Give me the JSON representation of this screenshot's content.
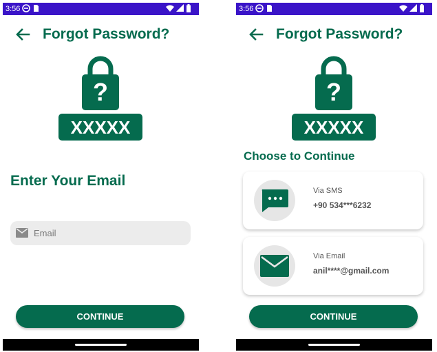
{
  "status_bar": {
    "time": "3:56"
  },
  "screens": {
    "enter_email": {
      "title": "Forgot Password?",
      "heading": "Enter Your Email",
      "email_placeholder": "Email",
      "continue_label": "CONTINUE"
    },
    "choose_method": {
      "title": "Forgot Password?",
      "heading": "Choose to Continue",
      "options": [
        {
          "label": "Via SMS",
          "value": "+90 534***6232",
          "icon": "sms-icon"
        },
        {
          "label": "Via Email",
          "value": "anil****@gmail.com",
          "icon": "email-icon"
        }
      ],
      "continue_label": "CONTINUE"
    }
  },
  "lock_graphic": {
    "code_mask": "XXXXX"
  },
  "colors": {
    "brand": "#056b4e",
    "status_bar": "#3a14c8",
    "field_bg": "#ececec"
  }
}
